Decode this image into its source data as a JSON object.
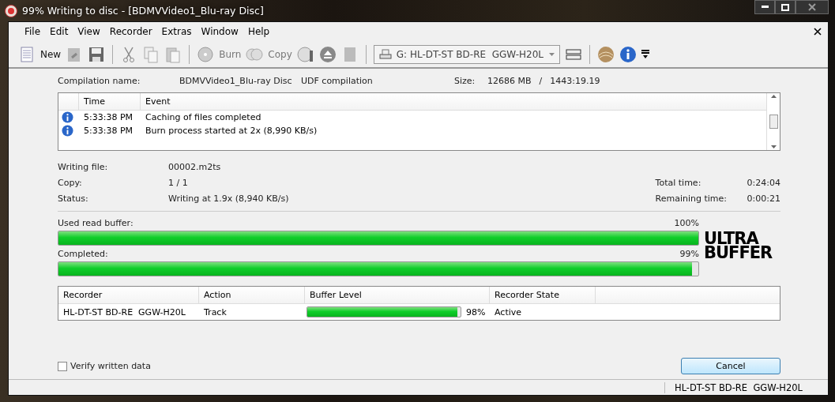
{
  "window": {
    "title": "99% Writing to disc - [BDMVVideo1_Blu-ray Disc]"
  },
  "menu": [
    "File",
    "Edit",
    "View",
    "Recorder",
    "Extras",
    "Window",
    "Help"
  ],
  "toolbar": {
    "new": "New",
    "burn": "Burn",
    "copy": "Copy",
    "recorder": "G: HL-DT-ST BD-RE  GGW-H20L"
  },
  "compilation": {
    "label": "Compilation name:",
    "name": "BDMVVideo1_Blu-ray Disc",
    "type": "UDF compilation",
    "size_label": "Size:",
    "size": "12686 MB",
    "separator": "/",
    "duration": "1443:19.19"
  },
  "events": {
    "columns": [
      "Time",
      "Event"
    ],
    "rows": [
      {
        "time": "5:33:38 PM",
        "event": "Caching of files completed"
      },
      {
        "time": "5:33:38 PM",
        "event": "Burn process started at 2x (8,990 KB/s)"
      }
    ]
  },
  "info_left": [
    {
      "label": "Writing file:",
      "value": "00002.m2ts"
    },
    {
      "label": "Copy:",
      "value": "1 / 1"
    },
    {
      "label": "Status:",
      "value": "Writing at 1.9x (8,940 KB/s)"
    }
  ],
  "info_right": [
    {
      "label": "Total time:",
      "value": "0:24:04"
    },
    {
      "label": "Remaining time:",
      "value": "0:00:21"
    }
  ],
  "progress": [
    {
      "label": "Used read buffer:",
      "reading": "100%",
      "level": 1.0
    },
    {
      "label": "Completed:",
      "reading": "99%",
      "level": 0.99
    }
  ],
  "logo": [
    "ULTRA",
    "BUFFER"
  ],
  "recorders": {
    "columns": [
      "Recorder",
      "Action",
      "Buffer Level",
      "Recorder State"
    ],
    "rows": [
      {
        "recorder": "HL-DT-ST BD-RE  GGW-H20L",
        "action": "Track",
        "level": 0.98,
        "reading": "98%",
        "state": "Active"
      }
    ]
  },
  "verify": {
    "label": "Verify written data",
    "checked": false
  },
  "cancel": "Cancel",
  "status_bar": "HL-DT-ST BD-RE  GGW-H20L"
}
